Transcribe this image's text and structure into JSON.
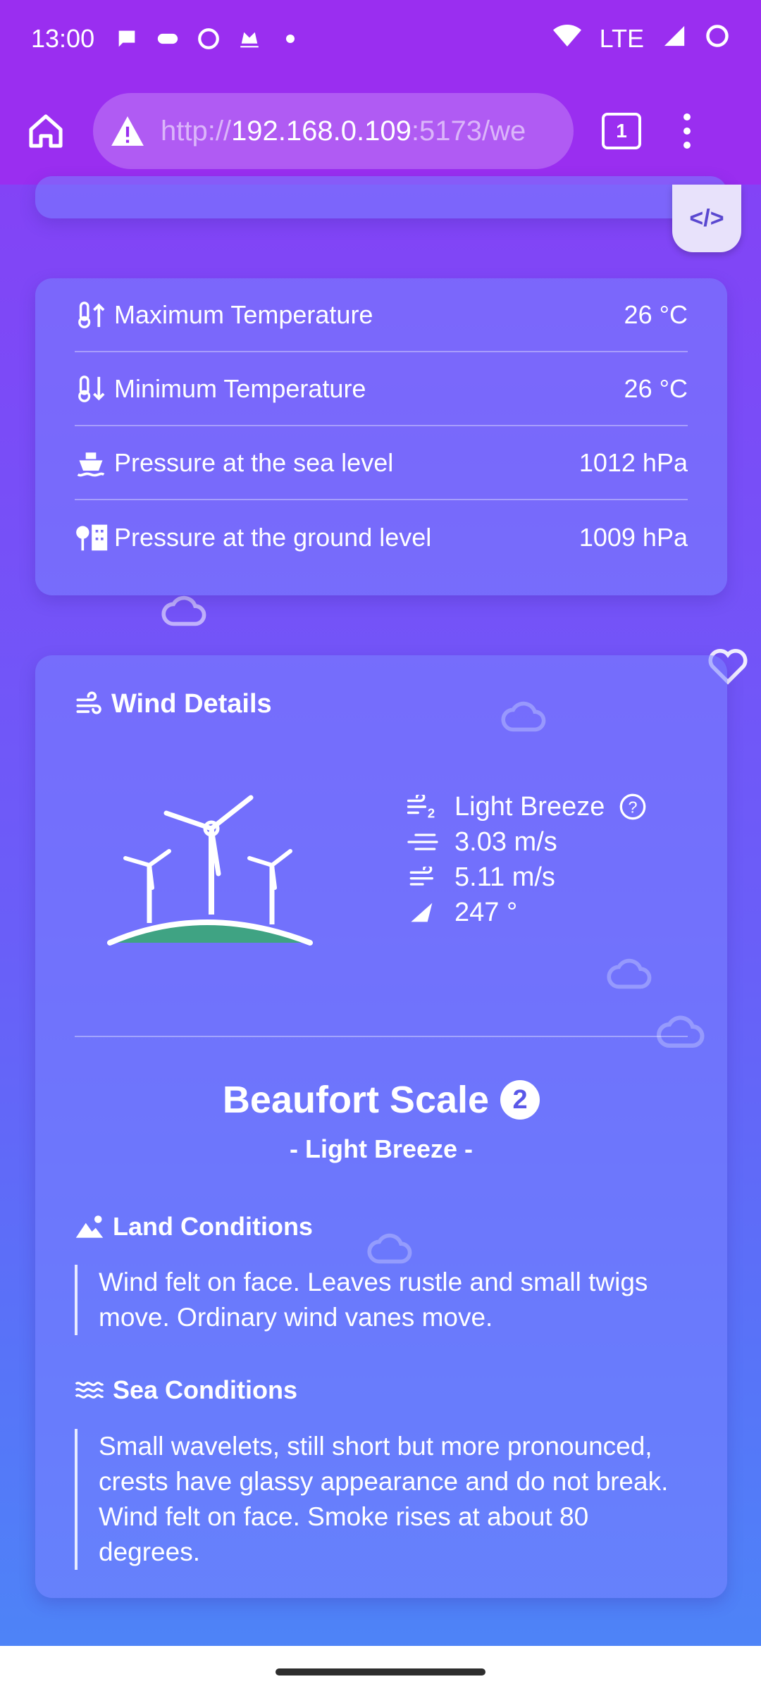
{
  "status_bar": {
    "time": "13:00",
    "network": "LTE"
  },
  "browser": {
    "url_prefix": "http://",
    "url_host": "192.168.0.109",
    "url_rest": ":5173/we",
    "tab_count": "1"
  },
  "stats": [
    {
      "label": "Maximum Temperature",
      "value": "26 °C",
      "icon": "thermometer-up-icon"
    },
    {
      "label": "Minimum Temperature",
      "value": "26 °C",
      "icon": "thermometer-down-icon"
    },
    {
      "label": "Pressure at the sea level",
      "value": "1012 hPa",
      "icon": "ship-icon"
    },
    {
      "label": "Pressure at the ground level",
      "value": "1009 hPa",
      "icon": "tree-building-icon"
    }
  ],
  "wind": {
    "title": "Wind Details",
    "description": "Light Breeze",
    "speed": "3.03 m/s",
    "gust": "5.11 m/s",
    "direction": "247 °",
    "beaufort_title": "Beaufort Scale",
    "beaufort_number": "2",
    "beaufort_subtitle": "- Light Breeze -",
    "land_title": "Land Conditions",
    "land_text": "Wind felt on face. Leaves rustle and small twigs move. Ordinary wind vanes move.",
    "sea_title": "Sea Conditions",
    "sea_text": "Small wavelets, still short but more pronounced, crests have glassy appearance and do not break. Wind felt on face. Smoke rises at about 80 degrees."
  },
  "colors": {
    "status_bar": "#9a2ef0",
    "ground": "#3fa383",
    "accent": "#5a48d0"
  }
}
